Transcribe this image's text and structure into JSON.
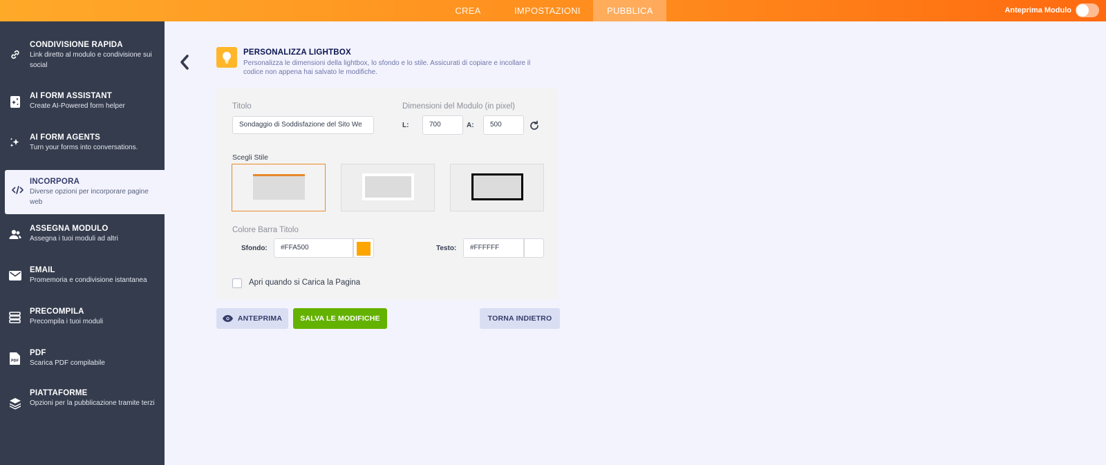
{
  "topbar": {
    "tabs": [
      {
        "label": "CREA"
      },
      {
        "label": "IMPOSTAZIONI"
      },
      {
        "label": "PUBBLICA",
        "active": true
      }
    ],
    "preview_label": "Anteprima Modulo",
    "preview_toggle_on": false
  },
  "sidebar": {
    "items": [
      {
        "title": "CONDIVISIONE RAPIDA",
        "subtitle": "Link diretto al modulo e condivisione sui social",
        "icon": "link-icon"
      },
      {
        "title": "AI FORM ASSISTANT",
        "subtitle": "Create AI-Powered form helper",
        "icon": "ai-assistant-icon"
      },
      {
        "title": "AI FORM AGENTS",
        "subtitle": "Turn your forms into conversations.",
        "icon": "sparkles-icon"
      },
      {
        "title": "INCORPORA",
        "subtitle": "Diverse opzioni per incorporare pagine web",
        "icon": "code-icon",
        "active": true
      },
      {
        "title": "ASSEGNA MODULO",
        "subtitle": "Assegna i tuoi moduli ad altri",
        "icon": "users-icon"
      },
      {
        "title": "EMAIL",
        "subtitle": "Promemoria e condivisione istantanea",
        "icon": "envelope-icon"
      },
      {
        "title": "PRECOMPILA",
        "subtitle": "Precompila i tuoi moduli",
        "icon": "prefill-icon"
      },
      {
        "title": "PDF",
        "subtitle": "Scarica PDF compilabile",
        "icon": "pdf-icon"
      },
      {
        "title": "PIATTAFORME",
        "subtitle": "Opzioni per la pubblicazione tramite terzi",
        "icon": "layers-icon"
      }
    ]
  },
  "header": {
    "title": "PERSONALIZZA LIGHTBOX",
    "description": "Personalizza le dimensioni della lightbox, lo sfondo e lo stile. Assicurati di copiare e incollare il codice non appena hai salvato le modifiche.",
    "icon": "lightbulb-icon"
  },
  "form": {
    "title_label": "Titolo",
    "title_value": "Sondaggio di Soddisfazione del Sito We",
    "dimensions_label": "Dimensioni del Modulo (in pixel)",
    "width_label": "L:",
    "width_value": "700",
    "height_label": "A:",
    "height_value": "500",
    "style_label": "Scegli Stile",
    "selected_style": 1,
    "titlebar_color_label": "Colore Barra Titolo",
    "background_label": "Sfondo:",
    "background_value": "#FFA500",
    "text_label": "Testo:",
    "text_value": "#FFFFFF",
    "open_on_load_label": "Apri quando si Carica la Pagina",
    "open_on_load_checked": false
  },
  "buttons": {
    "preview": "ANTEPRIMA",
    "save": "SALVA LE MODIFICHE",
    "back": "TORNA INDIETRO"
  },
  "colors": {
    "accent": "#FFA500",
    "sidebar_bg": "#343C4D",
    "save_green": "#64B200"
  }
}
